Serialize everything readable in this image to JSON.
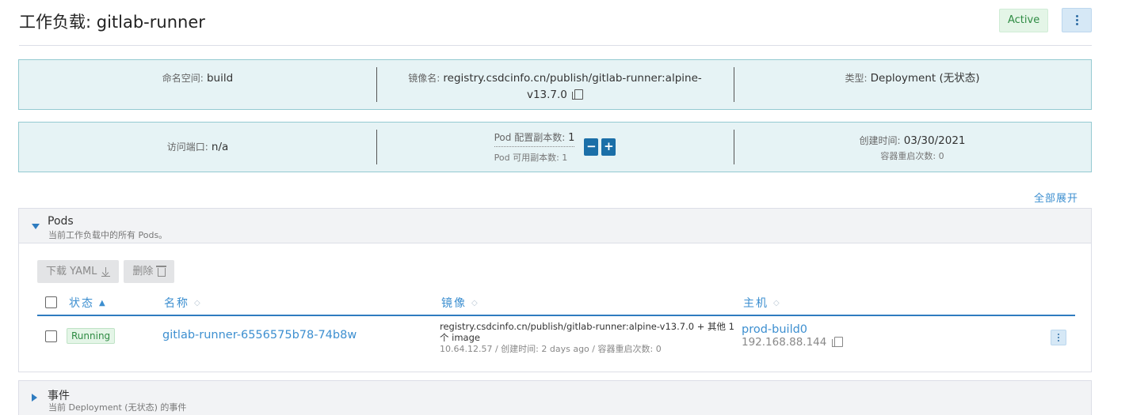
{
  "header": {
    "title": "工作负载: gitlab-runner",
    "status": "Active"
  },
  "info1": {
    "namespace_label": "命名空间:",
    "namespace_value": "build",
    "image_label": "镜像名:",
    "image_value_line1": "registry.csdcinfo.cn/publish/gitlab-runner:alpine-",
    "image_value_line2": "v13.7.0",
    "type_label": "类型:",
    "type_value": "Deployment (无状态)"
  },
  "info2": {
    "port_label": "访问端口:",
    "port_value": "n/a",
    "pod_config_label": "Pod 配置副本数:",
    "pod_config_value": "1",
    "pod_available": "Pod 可用副本数: 1",
    "minus": "−",
    "plus": "+",
    "created_label": "创建时间:",
    "created_value": "03/30/2021",
    "restart_count": "容器重启次数: 0"
  },
  "expand_all": "全部展开",
  "pods_section": {
    "title": "Pods",
    "description": "当前工作负载中的所有 Pods。",
    "download_yaml": "下载 YAML",
    "delete": "删除",
    "columns": {
      "status": "状态",
      "name": "名称",
      "image": "镜像",
      "host": "主机"
    },
    "rows": [
      {
        "status": "Running",
        "name": "gitlab-runner-6556575b78-74b8w",
        "image": "registry.csdcinfo.cn/publish/gitlab-runner:alpine-v13.7.0 + 其他 1 个 image",
        "meta": "10.64.12.57 / 创建时间: 2 days ago / 容器重启次数: 0",
        "host_name": "prod-build0",
        "host_ip": "192.168.88.144"
      }
    ]
  },
  "events_section": {
    "title": "事件",
    "description": "当前 Deployment (无状态) 的事件"
  },
  "icons": {
    "kebab": "more-vertical-icon",
    "copy": "copy-icon",
    "download": "download-icon",
    "trash": "trash-icon",
    "sort": "sort-icon",
    "caret_down": "caret-down-icon",
    "caret_right": "caret-right-icon"
  },
  "colors": {
    "accent": "#3d8fd0",
    "active_green": "#2e8b43",
    "info_bg": "#e6f3f5",
    "info_border": "#94cad1",
    "scale_button": "#1b6fa8"
  }
}
